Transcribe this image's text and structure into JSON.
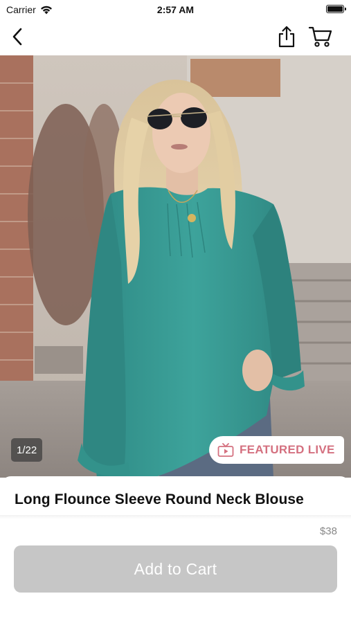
{
  "status_bar": {
    "carrier": "Carrier",
    "time": "2:57 AM"
  },
  "nav": {
    "back_icon": "chevron-left-icon",
    "share_icon": "share-icon",
    "cart_icon": "cart-icon"
  },
  "gallery": {
    "counter": "1/22",
    "badge_label": "FEATURED LIVE",
    "badge_icon": "live-tv-icon",
    "badge_color": "#d4707f"
  },
  "product": {
    "title": "Long Flounce Sleeve Round Neck Blouse",
    "price": "$38",
    "add_to_cart_label": "Add to Cart",
    "button_color": "#c6c6c6"
  }
}
